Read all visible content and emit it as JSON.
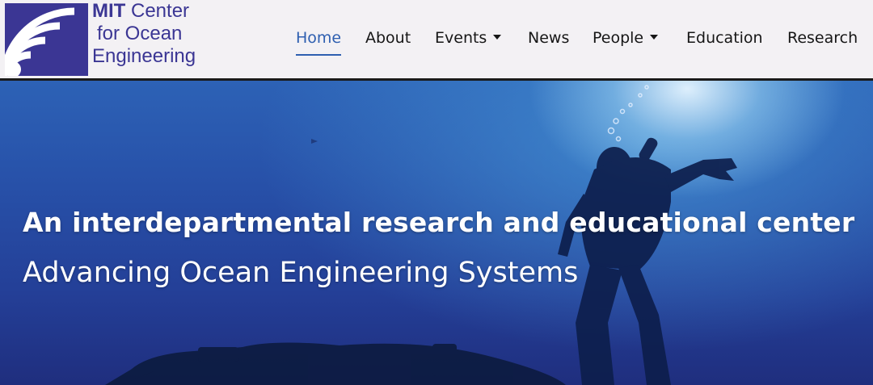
{
  "logo": {
    "line1_bold": "MIT",
    "line1_rest": " Center",
    "line2": "for Ocean",
    "line3": "Engineering",
    "icon": "wave-arcs-logo-icon",
    "color": "#3b3694"
  },
  "nav": {
    "items": [
      {
        "label": "Home",
        "active": true
      },
      {
        "label": "About"
      },
      {
        "label": "Events",
        "dropdown": true
      },
      {
        "label": "News"
      },
      {
        "label": "People",
        "dropdown": true
      },
      {
        "label": "Education"
      },
      {
        "label": "Research"
      }
    ],
    "active_color": "#2e5fb0"
  },
  "hero": {
    "title": "An interdepartmental research and educational center",
    "subtitle": "Advancing Ocean Engineering Systems",
    "image": "underwater-diver-photo"
  }
}
